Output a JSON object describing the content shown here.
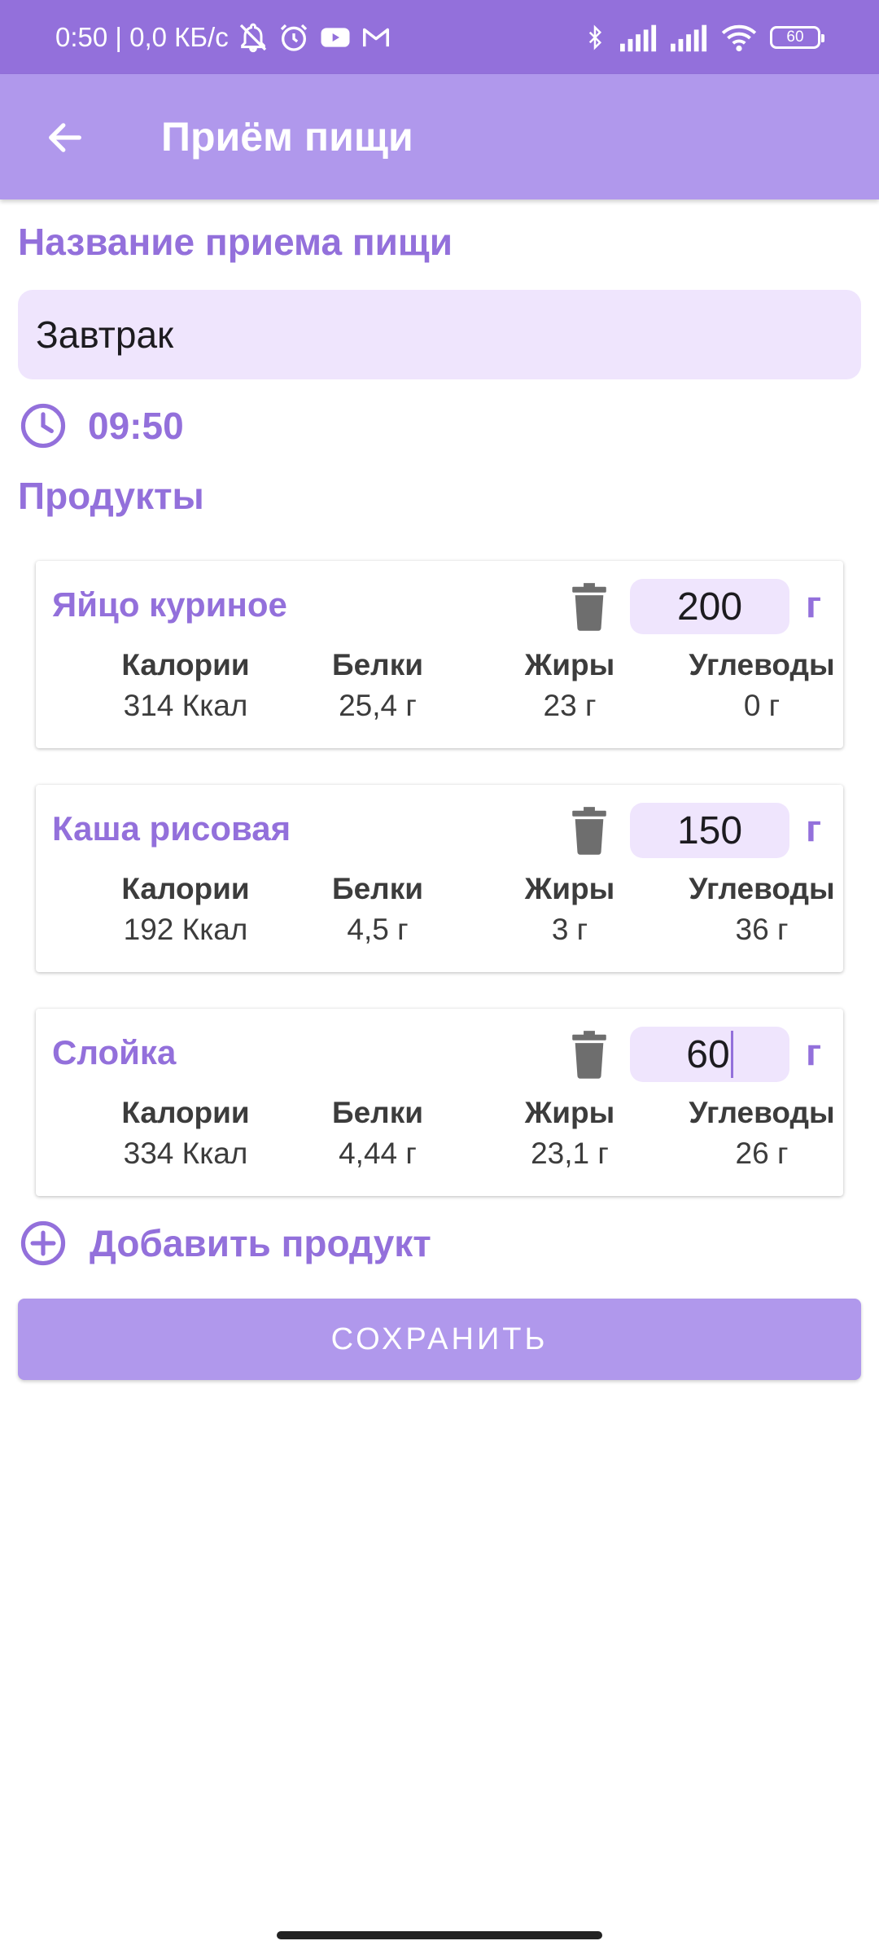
{
  "status_bar": {
    "time_speed": "0:50 | 0,0 КБ/с",
    "battery": "60"
  },
  "app_bar": {
    "title": "Приём пищи"
  },
  "meal_name_label": "Название приема пищи",
  "meal_name_value": "Завтрак",
  "time": "09:50",
  "products_label": "Продукты",
  "nutrient_labels": [
    "Калории",
    "Белки",
    "Жиры",
    "Углеводы"
  ],
  "products": [
    {
      "name": "Яйцо куриное",
      "weight": "200",
      "unit": "г",
      "values": [
        "314 Ккал",
        "25,4 г",
        "23 г",
        "0 г"
      ]
    },
    {
      "name": "Каша рисовая",
      "weight": "150",
      "unit": "г",
      "values": [
        "192 Ккал",
        "4,5 г",
        "3 г",
        "36 г"
      ]
    },
    {
      "name": "Слойка",
      "weight": "60",
      "unit": "г",
      "values": [
        "334 Ккал",
        "4,44 г",
        "23,1 г",
        "26 г"
      ]
    }
  ],
  "add_product_label": "Добавить продукт",
  "save_label": "СОХРАНИТЬ",
  "colors": {
    "accent": "#9370db",
    "app_bar": "#b098ec",
    "field_bg": "#efe5fd"
  }
}
